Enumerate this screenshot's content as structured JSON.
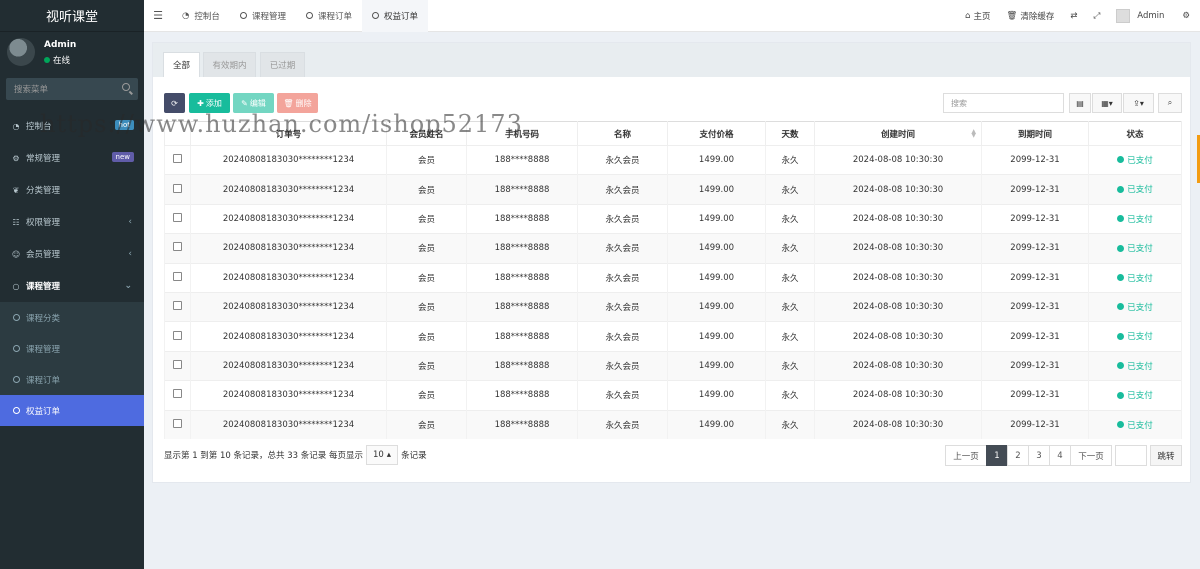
{
  "sidebar": {
    "logo": "视听课堂",
    "user": {
      "name": "Admin",
      "status": "在线"
    },
    "search_placeholder": "搜索菜单",
    "items": [
      {
        "label": "控制台",
        "icon": "dashboard-icon",
        "badge": "hot"
      },
      {
        "label": "常规管理",
        "icon": "cogs-icon",
        "badge": "new"
      },
      {
        "label": "分类管理",
        "icon": "leaf-icon"
      },
      {
        "label": "权限管理",
        "icon": "group-icon"
      },
      {
        "label": "会员管理",
        "icon": "user-circle-icon"
      },
      {
        "label": "课程管理",
        "icon": "circle-icon"
      }
    ],
    "subitems": [
      {
        "label": "课程分类"
      },
      {
        "label": "课程管理"
      },
      {
        "label": "课程订单"
      },
      {
        "label": "权益订单"
      }
    ]
  },
  "topbar": {
    "tabs": [
      {
        "label": "控制台"
      },
      {
        "label": "课程管理"
      },
      {
        "label": "课程订单"
      },
      {
        "label": "权益订单"
      }
    ],
    "home": "主页",
    "clear_cache": "清除缓存",
    "admin": "Admin"
  },
  "filter_tabs": [
    "全部",
    "有效期内",
    "已过期"
  ],
  "toolbar": {
    "add": "添加",
    "edit": "编辑",
    "delete": "删除",
    "search_placeholder": "搜索"
  },
  "table": {
    "headers": [
      "订单号",
      "会员姓名",
      "手机号码",
      "名称",
      "支付价格",
      "天数",
      "创建时间",
      "到期时间",
      "状态"
    ],
    "rows": [
      {
        "order": "20240808183030********1234",
        "member": "会员",
        "phone": "188****8888",
        "name": "永久会员",
        "price": "1499.00",
        "days": "永久",
        "created": "2024-08-08 10:30:30",
        "expire": "2099-12-31",
        "status": "已支付"
      },
      {
        "order": "20240808183030********1234",
        "member": "会员",
        "phone": "188****8888",
        "name": "永久会员",
        "price": "1499.00",
        "days": "永久",
        "created": "2024-08-08 10:30:30",
        "expire": "2099-12-31",
        "status": "已支付"
      },
      {
        "order": "20240808183030********1234",
        "member": "会员",
        "phone": "188****8888",
        "name": "永久会员",
        "price": "1499.00",
        "days": "永久",
        "created": "2024-08-08 10:30:30",
        "expire": "2099-12-31",
        "status": "已支付"
      },
      {
        "order": "20240808183030********1234",
        "member": "会员",
        "phone": "188****8888",
        "name": "永久会员",
        "price": "1499.00",
        "days": "永久",
        "created": "2024-08-08 10:30:30",
        "expire": "2099-12-31",
        "status": "已支付"
      },
      {
        "order": "20240808183030********1234",
        "member": "会员",
        "phone": "188****8888",
        "name": "永久会员",
        "price": "1499.00",
        "days": "永久",
        "created": "2024-08-08 10:30:30",
        "expire": "2099-12-31",
        "status": "已支付"
      },
      {
        "order": "20240808183030********1234",
        "member": "会员",
        "phone": "188****8888",
        "name": "永久会员",
        "price": "1499.00",
        "days": "永久",
        "created": "2024-08-08 10:30:30",
        "expire": "2099-12-31",
        "status": "已支付"
      },
      {
        "order": "20240808183030********1234",
        "member": "会员",
        "phone": "188****8888",
        "name": "永久会员",
        "price": "1499.00",
        "days": "永久",
        "created": "2024-08-08 10:30:30",
        "expire": "2099-12-31",
        "status": "已支付"
      },
      {
        "order": "20240808183030********1234",
        "member": "会员",
        "phone": "188****8888",
        "name": "永久会员",
        "price": "1499.00",
        "days": "永久",
        "created": "2024-08-08 10:30:30",
        "expire": "2099-12-31",
        "status": "已支付"
      },
      {
        "order": "20240808183030********1234",
        "member": "会员",
        "phone": "188****8888",
        "name": "永久会员",
        "price": "1499.00",
        "days": "永久",
        "created": "2024-08-08 10:30:30",
        "expire": "2099-12-31",
        "status": "已支付"
      },
      {
        "order": "20240808183030********1234",
        "member": "会员",
        "phone": "188****8888",
        "name": "永久会员",
        "price": "1499.00",
        "days": "永久",
        "created": "2024-08-08 10:30:30",
        "expire": "2099-12-31",
        "status": "已支付"
      }
    ]
  },
  "footer": {
    "summary": "显示第 1 到第 10 条记录，总共 33 条记录 每页显示",
    "page_size": "10",
    "suffix": "条记录"
  },
  "pagination": {
    "prev": "上一页",
    "pages": [
      "1",
      "2",
      "3",
      "4"
    ],
    "next": "下一页",
    "jump": "跳转"
  },
  "watermark": "https://www.huzhan.com/ishop52173",
  "colors": {
    "sidebar_bg": "#222d32",
    "active_menu": "#4e6be0",
    "paid": "#18bc9c",
    "btn_refresh": "#444c69",
    "btn_add": "#18bc9c",
    "btn_edit": "#73d6c2",
    "btn_delete": "#f3a49b"
  }
}
